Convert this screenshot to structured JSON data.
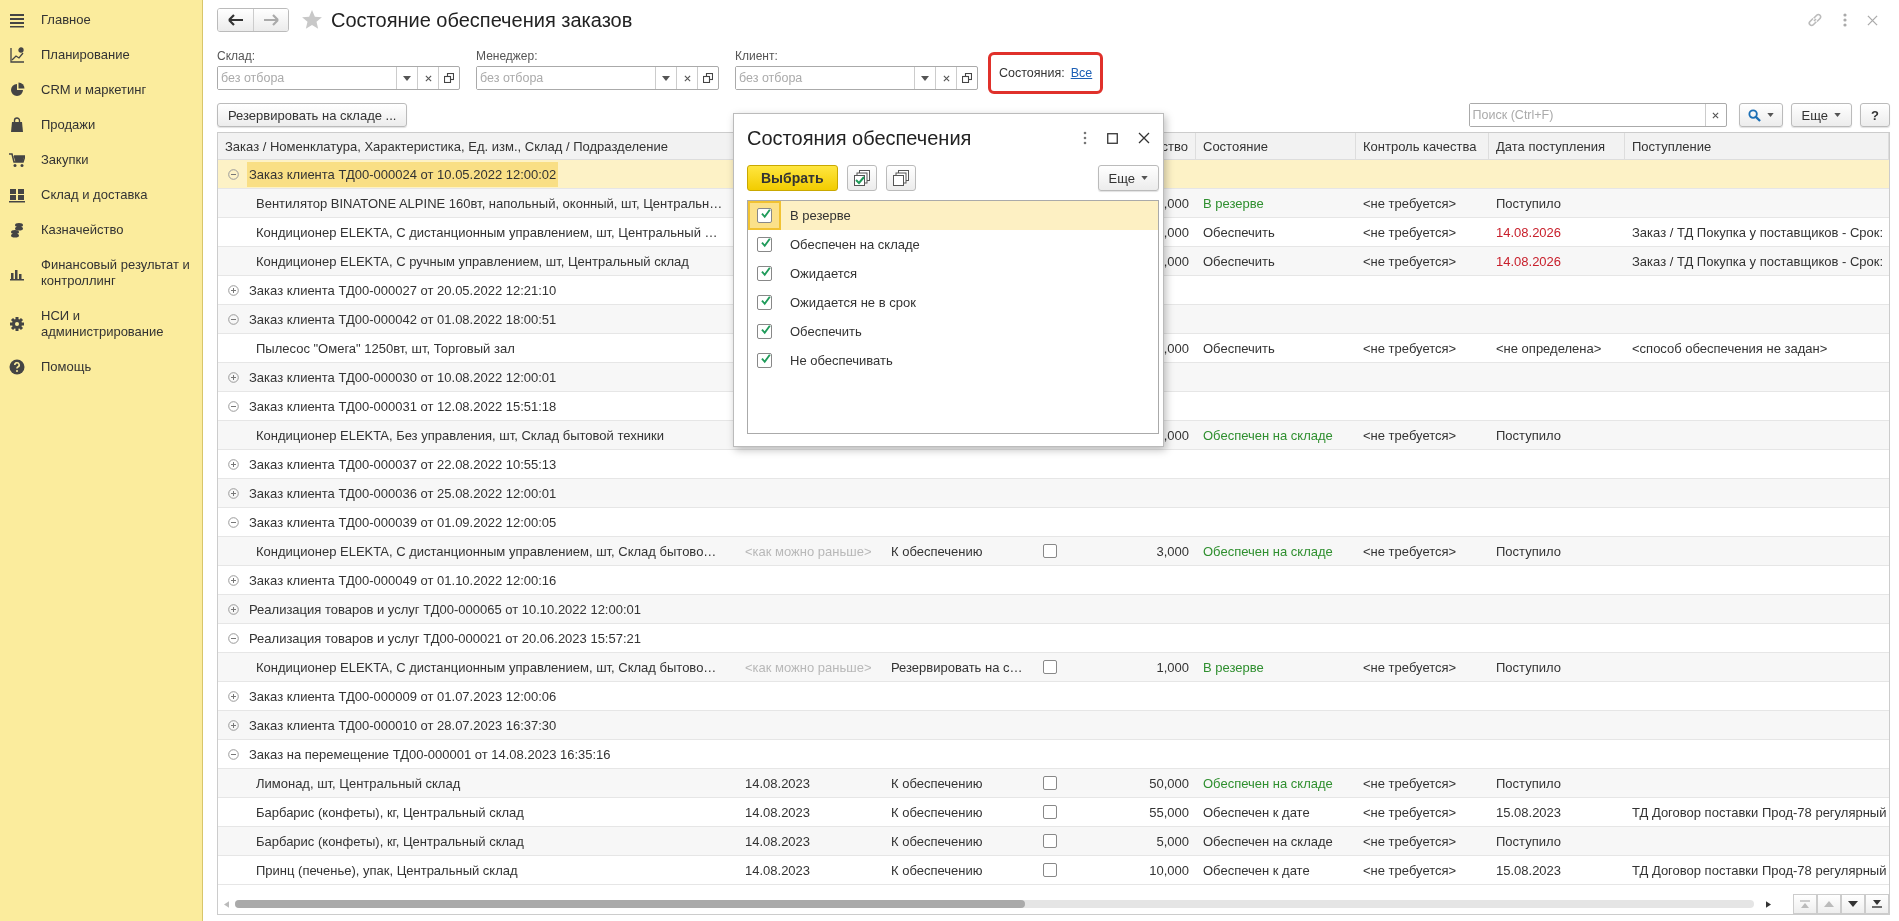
{
  "sidebar": {
    "items": [
      {
        "label": "Главное"
      },
      {
        "label": "Планирование"
      },
      {
        "label": "CRM и маркетинг"
      },
      {
        "label": "Продажи"
      },
      {
        "label": "Закупки"
      },
      {
        "label": "Склад и доставка"
      },
      {
        "label": "Казначейство"
      },
      {
        "label": "Финансовый результат и контроллинг"
      },
      {
        "label": "НСИ и администрирование"
      },
      {
        "label": "Помощь"
      }
    ]
  },
  "window": {
    "title": "Состояние обеспечения заказов"
  },
  "filters": [
    {
      "label": "Склад:",
      "placeholder": "без отбора"
    },
    {
      "label": "Менеджер:",
      "placeholder": "без отбора"
    },
    {
      "label": "Клиент:",
      "placeholder": "без отбора"
    }
  ],
  "states_filter": {
    "label": "Состояния:",
    "link": "Все"
  },
  "reserve_button": "Резервировать на складе ...",
  "search": {
    "placeholder": "Поиск (Ctrl+F)"
  },
  "toolbar": {
    "more": "Еще",
    "help": "?"
  },
  "table": {
    "columns": [
      {
        "label": "Заказ / Номенклатура, Характеристика, Ед. изм., Склад / Подразделение"
      },
      {
        "label": "ство"
      },
      {
        "label": "Состояние"
      },
      {
        "label": "Контроль качества"
      },
      {
        "label": "Дата поступления"
      },
      {
        "label": "Поступление"
      }
    ],
    "rows": [
      {
        "kind": "group",
        "text": "Заказ клиента ТД00-000024 от 10.05.2022 12:00:02",
        "expanded": true,
        "selected": true
      },
      {
        "kind": "item",
        "selected": false,
        "name": "Вентилятор BINATONE ALPINE 160вт, напольный, оконный, шт, Центральн…",
        "qty": ",000",
        "state": {
          "text": "В резерве",
          "color": "#2f8f2f"
        },
        "quality": "<не требуется>",
        "arrival_date": {
          "text": "Поступило",
          "color": "#333333"
        }
      },
      {
        "kind": "item",
        "selected": false,
        "name": "Кондиционер ELEKTA, С дистанционным управлением, шт, Центральный …",
        "qty": ",000",
        "state": {
          "text": "Обеспечить",
          "color": "#333333"
        },
        "quality": "<не требуется>",
        "arrival_date": {
          "text": "14.08.2026",
          "color": "#c8202c"
        },
        "arrival": "Заказ / ТД Покупка у поставщиков - Срок:"
      },
      {
        "kind": "item",
        "selected": false,
        "name": "Кондиционер ELEKTA, С ручным управлением, шт, Центральный склад",
        "qty": ",000",
        "state": {
          "text": "Обеспечить",
          "color": "#333333"
        },
        "quality": "<не требуется>",
        "arrival_date": {
          "text": "14.08.2026",
          "color": "#c8202c"
        },
        "arrival": "Заказ / ТД Покупка у поставщиков - Срок:"
      },
      {
        "kind": "group",
        "text": "Заказ клиента ТД00-000027 от 20.05.2022 12:21:10",
        "expanded": false,
        "selected": false
      },
      {
        "kind": "group",
        "text": "Заказ клиента ТД00-000042 от 01.08.2022 18:00:51",
        "expanded": true,
        "selected": false
      },
      {
        "kind": "item",
        "selected": false,
        "name": "Пылесос \"Омега\" 1250вт, шт, Торговый зал",
        "qty": ",000",
        "state": {
          "text": "Обеспечить",
          "color": "#333333"
        },
        "quality": "<не требуется>",
        "arrival_date": {
          "text": "<не определена>",
          "color": "#333333"
        },
        "arrival": "<способ обеспечения не задан>"
      },
      {
        "kind": "group",
        "text": "Заказ клиента ТД00-000030 от 10.08.2022 12:00:01",
        "expanded": false,
        "selected": false
      },
      {
        "kind": "group",
        "text": "Заказ клиента ТД00-000031 от 12.08.2022 15:51:18",
        "expanded": true,
        "selected": false
      },
      {
        "kind": "item",
        "selected": false,
        "name": "Кондиционер ELEKTA, Без управления, шт, Склад бытовой техники",
        "qty": ",000",
        "state": {
          "text": "Обеспечен на складе",
          "color": "#2f8f2f"
        },
        "quality": "<не требуется>",
        "arrival_date": {
          "text": "Поступило",
          "color": "#333333"
        }
      },
      {
        "kind": "group",
        "text": "Заказ клиента ТД00-000037 от 22.08.2022 10:55:13",
        "expanded": false,
        "selected": false
      },
      {
        "kind": "group",
        "text": "Заказ клиента ТД00-000036 от 25.08.2022 12:00:01",
        "expanded": false,
        "selected": false
      },
      {
        "kind": "group",
        "text": "Заказ клиента ТД00-000039 от 01.09.2022 12:00:05",
        "expanded": true,
        "selected": false
      },
      {
        "kind": "item",
        "selected": false,
        "name": "Кондиционер ELEKTA, С дистанционным управлением, шт, Склад бытово…",
        "date": {
          "text": "<как можно раньше>",
          "color": "#b8b8b8"
        },
        "action": "К обеспечению",
        "flag": false,
        "qty": "3,000",
        "state": {
          "text": "Обеспечен на складе",
          "color": "#2f8f2f"
        },
        "quality": "<не требуется>",
        "arrival_date": {
          "text": "Поступило",
          "color": "#333333"
        }
      },
      {
        "kind": "group",
        "text": "Заказ клиента ТД00-000049 от 01.10.2022 12:00:16",
        "expanded": false,
        "selected": false
      },
      {
        "kind": "group",
        "text": "Реализация товаров и услуг ТД00-000065 от 10.10.2022 12:00:01",
        "expanded": false,
        "selected": false
      },
      {
        "kind": "group",
        "text": "Реализация товаров и услуг ТД00-000021 от 20.06.2023 15:57:21",
        "expanded": true,
        "selected": false
      },
      {
        "kind": "item",
        "selected": false,
        "name": "Кондиционер ELEKTA, С дистанционным управлением, шт, Склад бытово…",
        "date": {
          "text": "<как можно раньше>",
          "color": "#b8b8b8"
        },
        "action": "Резервировать на с…",
        "flag": false,
        "qty": "1,000",
        "state": {
          "text": "В резерве",
          "color": "#2f8f2f"
        },
        "quality": "<не требуется>",
        "arrival_date": {
          "text": "Поступило",
          "color": "#333333"
        }
      },
      {
        "kind": "group",
        "text": "Заказ клиента ТД00-000009 от 01.07.2023 12:00:06",
        "expanded": false,
        "selected": false
      },
      {
        "kind": "group",
        "text": "Заказ клиента ТД00-000010 от 28.07.2023 16:37:30",
        "expanded": false,
        "selected": false
      },
      {
        "kind": "group",
        "text": "Заказ на перемещение ТД00-000001 от 14.08.2023 16:35:16",
        "expanded": true,
        "selected": false
      },
      {
        "kind": "item",
        "selected": false,
        "name": "Лимонад, шт, Центральный склад",
        "date": {
          "text": "14.08.2023",
          "color": "#333333"
        },
        "action": "К обеспечению",
        "flag": false,
        "qty": "50,000",
        "state": {
          "text": "Обеспечен на складе",
          "color": "#2f8f2f"
        },
        "quality": "<не требуется>",
        "arrival_date": {
          "text": "Поступило",
          "color": "#333333"
        }
      },
      {
        "kind": "item",
        "selected": false,
        "name": "Барбарис (конфеты), кг, Центральный склад",
        "date": {
          "text": "14.08.2023",
          "color": "#333333"
        },
        "action": "К обеспечению",
        "flag": false,
        "qty": "55,000",
        "state": {
          "text": "Обеспечен к дате",
          "color": "#333333"
        },
        "quality": "<не требуется>",
        "arrival_date": {
          "text": "15.08.2023",
          "color": "#333333"
        },
        "arrival": "ТД Договор поставки Прод-78 регулярный"
      },
      {
        "kind": "item",
        "selected": false,
        "name": "Барбарис (конфеты), кг, Центральный склад",
        "date": {
          "text": "14.08.2023",
          "color": "#333333"
        },
        "action": "К обеспечению",
        "flag": false,
        "qty": "5,000",
        "state": {
          "text": "Обеспечен на складе",
          "color": "#333333"
        },
        "quality": "<не требуется>",
        "arrival_date": {
          "text": "Поступило",
          "color": "#333333"
        }
      },
      {
        "kind": "item",
        "selected": false,
        "name": "Принц (печенье), упак, Центральный склад",
        "date": {
          "text": "14.08.2023",
          "color": "#333333"
        },
        "action": "К обеспечению",
        "flag": false,
        "qty": "10,000",
        "state": {
          "text": "Обеспечен к дате",
          "color": "#333333"
        },
        "quality": "<не требуется>",
        "arrival_date": {
          "text": "15.08.2023",
          "color": "#333333"
        },
        "arrival": "ТД Договор поставки Прод-78 регулярный"
      }
    ]
  },
  "popup": {
    "title": "Состояния обеспечения",
    "select_button": "Выбрать",
    "more": "Еще",
    "items": [
      {
        "label": "В резерве",
        "checked": true,
        "selected": true
      },
      {
        "label": "Обеспечен на складе",
        "checked": true,
        "selected": false
      },
      {
        "label": "Ожидается",
        "checked": true,
        "selected": false
      },
      {
        "label": "Ожидается не в срок",
        "checked": true,
        "selected": false
      },
      {
        "label": "Обеспечить",
        "checked": true,
        "selected": false
      },
      {
        "label": "Не обеспечивать",
        "checked": true,
        "selected": false
      }
    ]
  }
}
